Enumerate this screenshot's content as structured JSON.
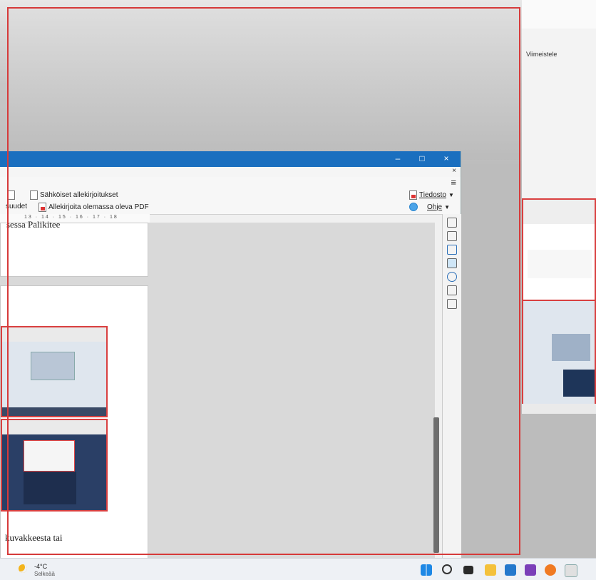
{
  "background": {
    "ribbon_tab_label": "Viimeistele"
  },
  "window": {
    "close_glyph": "×",
    "minimize_glyph": "–",
    "maximize_glyph": "□",
    "menu_glyph": "≡"
  },
  "toolbar": {
    "digital_signatures": "Sähköiset allekirjoitukset",
    "properties_partial": "suudet",
    "sign_existing_pdf": "Allekirjoita olemassa oleva PDF",
    "file_menu": "Tiedosto",
    "help_menu": "Ohje"
  },
  "ruler": {
    "ticks": "13 · 14 · 15 · 16 · 17 · 18"
  },
  "document": {
    "page1_text": "sessa Palikitee",
    "page2_caption": "kuvakkeesta tai"
  },
  "sidebar": {
    "icons": [
      "menu-icon",
      "properties-icon",
      "styles-icon",
      "gallery-icon",
      "navigator-icon",
      "page-icon",
      "manage-changes-icon"
    ]
  },
  "taskbar": {
    "temperature": "-4°C",
    "condition": "Selkeää",
    "apps": [
      "windows-start-icon",
      "search-icon",
      "task-view-icon",
      "file-explorer-icon",
      "mail-icon",
      "onenote-icon",
      "firefox-icon",
      "app-icon"
    ]
  },
  "colors": {
    "accent": "#1a6fbf",
    "selection": "#d63a3a"
  }
}
